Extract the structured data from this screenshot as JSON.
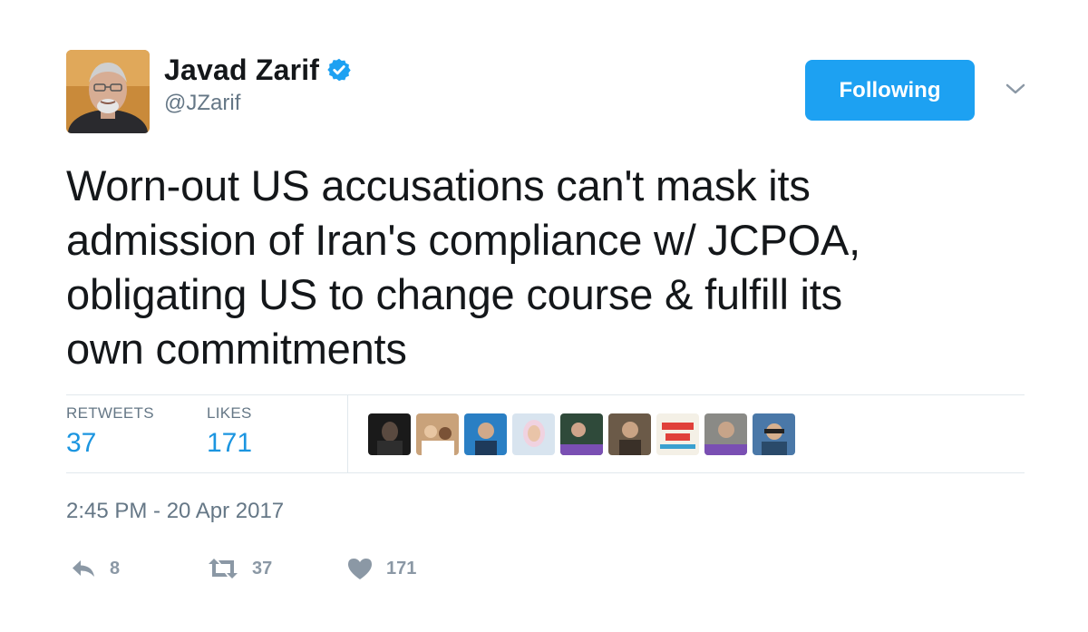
{
  "author": {
    "display_name": "Javad Zarif",
    "handle": "@JZarif",
    "verified": true,
    "avatar_icon": "profile-photo"
  },
  "follow_button": {
    "label": "Following",
    "color": "#1da1f2"
  },
  "menu": {
    "icon": "chevron-down-icon"
  },
  "tweet": {
    "text": "Worn-out US accusations can't mask its\nadmission of Iran's compliance w/ JCPOA,\nobligating US to change course & fulfill its\nown commitments"
  },
  "stats": {
    "retweets_label": "RETWEETS",
    "retweets_value": "37",
    "likes_label": "LIKES",
    "likes_value": "171"
  },
  "likers": {
    "count_shown": 9
  },
  "timestamp": "2:45 PM - 20 Apr 2017",
  "actions": {
    "reply_icon": "reply-icon",
    "reply_count": "8",
    "retweet_icon": "retweet-icon",
    "retweet_count": "37",
    "like_icon": "heart-icon",
    "like_count": "171"
  },
  "colors": {
    "link_blue": "#1b95e0",
    "muted_gray": "#657786",
    "action_gray": "#8b98a5",
    "divider": "#e1e8ed"
  }
}
